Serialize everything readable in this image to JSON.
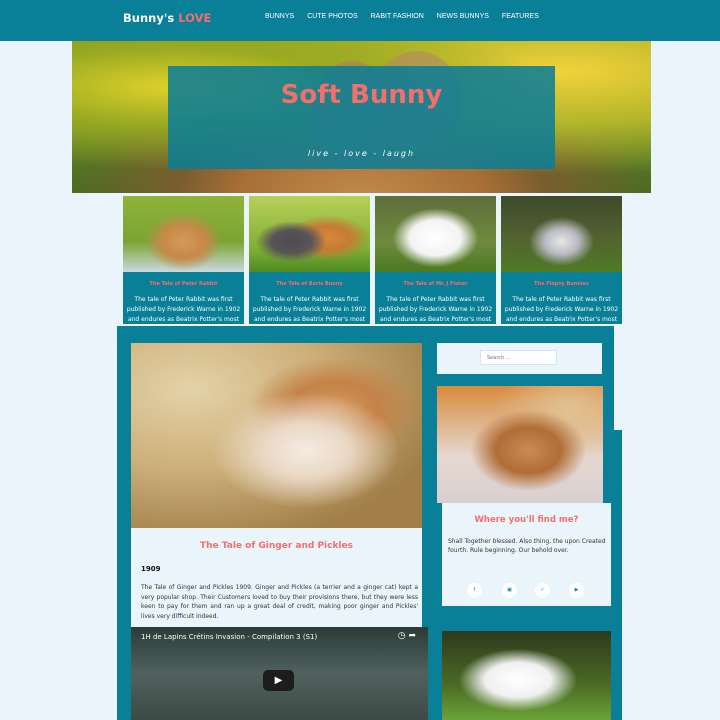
{
  "header": {
    "logo_main": "Bunny's",
    "logo_accent": "LOVE",
    "nav": [
      "BUNNYS",
      "CUTE PHOTOS",
      "RABIT FASHION",
      "NEWS BUNNYS",
      "FEATURES"
    ]
  },
  "hero": {
    "title": "Soft Bunny",
    "tagline": "live - love - laugh"
  },
  "cards": [
    {
      "title": "The Tale of Peter Rabbit",
      "text": "The tale of Peter Rabbit was first published by Frederick Warne in 1902 and endures as Beatrix Potter's most popular and well-loved tale."
    },
    {
      "title": "The Tale of Boris Bunny",
      "text": "The tale of Peter Rabbit was first published by Frederick Warne in 1902 and endures as Beatrix Potter's most popular and well-loved tale."
    },
    {
      "title": "The Tale of Mr. J Fisher",
      "text": "The tale of Peter Rabbit was first published by Frederick Warne in 1902 and endures as Beatrix Potter's most popular and well-loved tale."
    },
    {
      "title": "The Flopsy Bunnies",
      "text": "The tale of Peter Rabbit was first published by Frederick Warne in 1902 and endures as Beatrix Potter's most popular and well-loved tale."
    }
  ],
  "post": {
    "title": "The Tale of Ginger and Pickles",
    "year": "1909",
    "body": "The Tale of Ginger and Pickles 1909. Ginger and Pickles (a terrier and a ginger cat) kept a very popular shop. Their Customers loved to buy their provisions there, but they were less keen to pay for them and ran up a great deal of credit, making poor ginger and Pickles' lives very difficult indeed."
  },
  "video": {
    "title": "1H de Lapins Crétins Invasion - Compilation 3 (S1)"
  },
  "sidebar": {
    "search_placeholder": "Search ...",
    "find_title": "Where you'll find me?",
    "find_text": "Shall Together blessed. Also thing, the upon Created fourth. Rule beginning. Our behold over.",
    "social_icons": [
      "facebook-icon",
      "instagram-icon",
      "twitter-icon",
      "youtube-icon"
    ]
  },
  "colors": {
    "teal": "#0a7f98",
    "coral": "#f36f6c",
    "background": "#e9f5fa"
  }
}
